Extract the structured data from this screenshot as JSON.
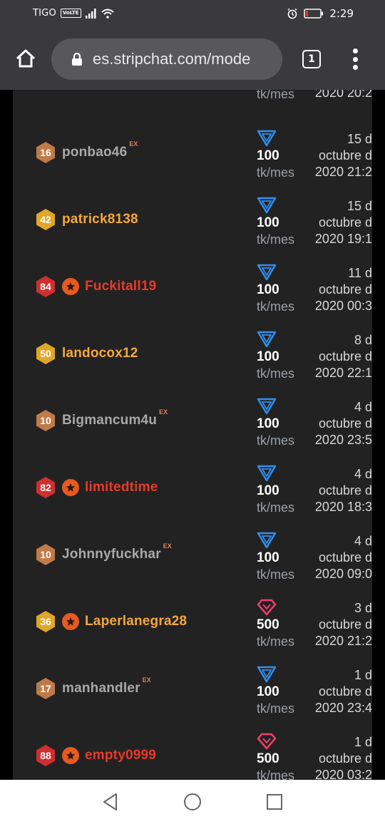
{
  "status_bar": {
    "carrier": "TIGO",
    "volte": "VoLTE",
    "time": "2:29"
  },
  "browser": {
    "url": "es.stripchat.com/mode",
    "tab_count": "1"
  },
  "partial_row": {
    "unit": "tk/mes",
    "date_last_line": "2020 20:2"
  },
  "rows": [
    {
      "level": "16",
      "badge_color": "#c07a48",
      "username": "ponbao46",
      "name_color": "#a9a9a9",
      "ex": "EX",
      "star": false,
      "icon": "diamond-outline",
      "amount": "100",
      "unit": "tk/mes",
      "date": [
        "15 d",
        "octubre d",
        "2020 21:2"
      ]
    },
    {
      "level": "42",
      "badge_color": "#e0a628",
      "username": "patrick8138",
      "name_color": "#f5a83a",
      "ex": "",
      "star": false,
      "icon": "diamond-outline",
      "amount": "100",
      "unit": "tk/mes",
      "date": [
        "15 d",
        "octubre d",
        "2020 19:1"
      ]
    },
    {
      "level": "84",
      "badge_color": "#d02f2f",
      "username": "Fuckitall19",
      "name_color": "#e83a2a",
      "ex": "",
      "star": true,
      "icon": "diamond-outline",
      "amount": "100",
      "unit": "tk/mes",
      "date": [
        "11 d",
        "octubre d",
        "2020 00:3"
      ]
    },
    {
      "level": "50",
      "badge_color": "#e0a628",
      "username": "landocox12",
      "name_color": "#f5a83a",
      "ex": "",
      "star": false,
      "icon": "diamond-outline",
      "amount": "100",
      "unit": "tk/mes",
      "date": [
        "8 d",
        "octubre d",
        "2020 22:1"
      ]
    },
    {
      "level": "10",
      "badge_color": "#c07a48",
      "username": "Bigmancum4u",
      "name_color": "#a9a9a9",
      "ex": "EX",
      "star": false,
      "icon": "diamond-outline",
      "amount": "100",
      "unit": "tk/mes",
      "date": [
        "4 d",
        "octubre d",
        "2020 23:5"
      ]
    },
    {
      "level": "82",
      "badge_color": "#d02f2f",
      "username": "limitedtime",
      "name_color": "#e83a2a",
      "ex": "",
      "star": true,
      "icon": "diamond-outline",
      "amount": "100",
      "unit": "tk/mes",
      "date": [
        "4 d",
        "octubre d",
        "2020 18:3"
      ]
    },
    {
      "level": "10",
      "badge_color": "#c07a48",
      "username": "Johnnyfuckhar",
      "name_color": "#a9a9a9",
      "ex": "EX",
      "star": false,
      "icon": "diamond-outline",
      "amount": "100",
      "unit": "tk/mes",
      "date": [
        "4 d",
        "octubre d",
        "2020 09:0"
      ]
    },
    {
      "level": "36",
      "badge_color": "#e0a628",
      "username": "Laperlanegra28",
      "name_color": "#f5a83a",
      "ex": "",
      "star": true,
      "icon": "gem-outline",
      "amount": "500",
      "unit": "tk/mes",
      "date": [
        "3 d",
        "octubre d",
        "2020 21:2"
      ]
    },
    {
      "level": "17",
      "badge_color": "#c07a48",
      "username": "manhandler",
      "name_color": "#a9a9a9",
      "ex": "EX",
      "star": false,
      "icon": "diamond-outline",
      "amount": "100",
      "unit": "tk/mes",
      "date": [
        "1 d",
        "octubre d",
        "2020 23:4"
      ]
    },
    {
      "level": "88",
      "badge_color": "#d02f2f",
      "username": "empty0999",
      "name_color": "#e83a2a",
      "ex": "",
      "star": true,
      "icon": "gem-outline",
      "amount": "500",
      "unit": "tk/mes",
      "date": [
        "1 d",
        "octubre d",
        "2020 03:2"
      ]
    }
  ],
  "colors": {
    "blue_icon": "#2f8ff0",
    "pink_icon": "#f0406a",
    "star": "#e85a1e"
  }
}
